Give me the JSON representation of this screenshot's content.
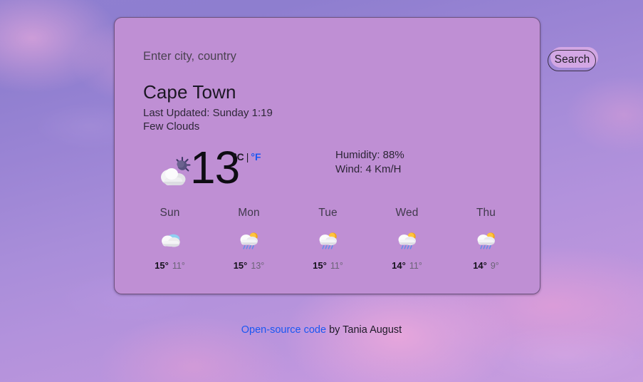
{
  "app": {
    "background_style": "photo-sky-pink-purple",
    "card_color": "#bf8fd4",
    "accent_link_color": "#1a57f2"
  },
  "search": {
    "placeholder": "Enter city, country",
    "value": "",
    "button_label": "Search"
  },
  "current": {
    "city": "Cape Town",
    "last_updated": "Last Updated: Sunday 1:19",
    "condition": "Few Clouds",
    "icon": "cloud-moon-icon",
    "temperature": "13",
    "unit_celsius": "°C",
    "unit_separator": "|",
    "unit_fahrenheit": "°F",
    "active_unit": "°F",
    "humidity": "Humidity: 88%",
    "wind": "Wind: 4 Km/H"
  },
  "forecast": [
    {
      "day": "Sun",
      "icon": "cloud-icon",
      "max": "15°",
      "min": "11°"
    },
    {
      "day": "Mon",
      "icon": "sun-rain-cloud-icon",
      "max": "15°",
      "min": "13°"
    },
    {
      "day": "Tue",
      "icon": "sun-rain-cloud-icon",
      "max": "15°",
      "min": "11°"
    },
    {
      "day": "Wed",
      "icon": "sun-rain-cloud-icon",
      "max": "14°",
      "min": "11°"
    },
    {
      "day": "Thu",
      "icon": "sun-rain-cloud-icon",
      "max": "14°",
      "min": "9°"
    }
  ],
  "footer": {
    "link_text": "Open-source code",
    "author_text": " by Tania August"
  }
}
